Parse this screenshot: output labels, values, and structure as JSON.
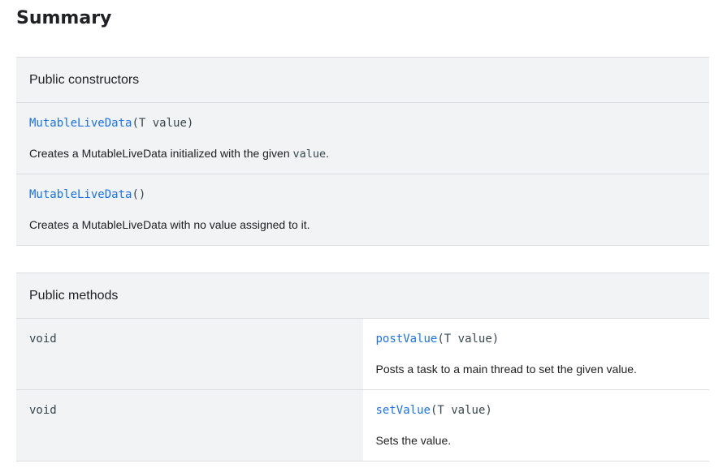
{
  "page": {
    "title": "Summary"
  },
  "constructors": {
    "header": "Public constructors",
    "items": [
      {
        "name": "MutableLiveData",
        "params": "(T value)",
        "desc_prefix": "Creates a MutableLiveData initialized with the given ",
        "desc_code": "value",
        "desc_suffix": "."
      },
      {
        "name": "MutableLiveData",
        "params": "()",
        "desc_prefix": "Creates a MutableLiveData with no value assigned to it.",
        "desc_code": "",
        "desc_suffix": ""
      }
    ]
  },
  "methods": {
    "header": "Public methods",
    "items": [
      {
        "return_type": "void",
        "name": "postValue",
        "params": "(T value)",
        "desc": "Posts a task to a main thread to set the given value."
      },
      {
        "return_type": "void",
        "name": "setValue",
        "params": "(T value)",
        "desc": "Sets the value."
      }
    ]
  },
  "colors": {
    "link": "#1a73e8",
    "header_bg": "#f1f3f4",
    "border": "#dadce0"
  }
}
